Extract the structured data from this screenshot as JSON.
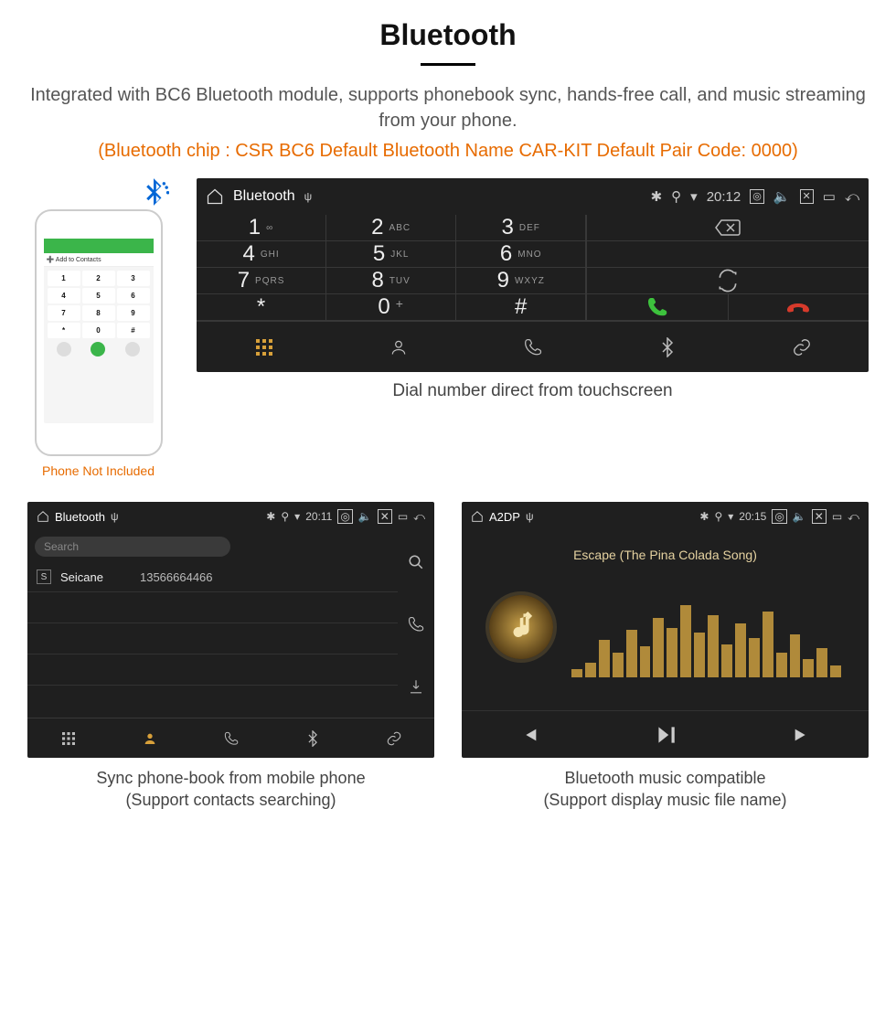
{
  "title": "Bluetooth",
  "description": "Integrated with BC6 Bluetooth module, supports phonebook sync, hands-free call, and music streaming from your phone.",
  "meta": "(Bluetooth chip : CSR BC6     Default Bluetooth Name CAR-KIT     Default Pair Code: 0000)",
  "phone_caption": "Phone Not Included",
  "phone": {
    "add_label": "Add to Contacts",
    "keys": [
      "1",
      "2",
      "3",
      "4",
      "5",
      "6",
      "7",
      "8",
      "9",
      "*",
      "0",
      "#"
    ]
  },
  "dialer": {
    "app_title": "Bluetooth",
    "time": "20:12",
    "keys": [
      {
        "digit": "1",
        "letters": "∞"
      },
      {
        "digit": "2",
        "letters": "ABC"
      },
      {
        "digit": "3",
        "letters": "DEF"
      },
      {
        "digit": "4",
        "letters": "GHI"
      },
      {
        "digit": "5",
        "letters": "JKL"
      },
      {
        "digit": "6",
        "letters": "MNO"
      },
      {
        "digit": "7",
        "letters": "PQRS"
      },
      {
        "digit": "8",
        "letters": "TUV"
      },
      {
        "digit": "9",
        "letters": "WXYZ"
      },
      {
        "digit": "*",
        "letters": ""
      },
      {
        "digit": "0",
        "letters": "+"
      },
      {
        "digit": "#",
        "letters": ""
      }
    ],
    "caption": "Dial number direct from touchscreen"
  },
  "phonebook": {
    "app_title": "Bluetooth",
    "time": "20:11",
    "search_placeholder": "Search",
    "contact_label": "S",
    "contact_name": "Seicane",
    "contact_number": "13566664466",
    "caption": "Sync phone-book from mobile phone\n(Support contacts searching)"
  },
  "music": {
    "app_title": "A2DP",
    "time": "20:15",
    "track": "Escape (The Pina Colada Song)",
    "caption": "Bluetooth music compatible\n(Support display music file name)",
    "eq_heights": [
      10,
      18,
      46,
      30,
      58,
      38,
      72,
      60,
      88,
      55,
      76,
      40,
      66,
      48,
      80,
      30,
      52,
      22,
      36,
      14
    ]
  }
}
